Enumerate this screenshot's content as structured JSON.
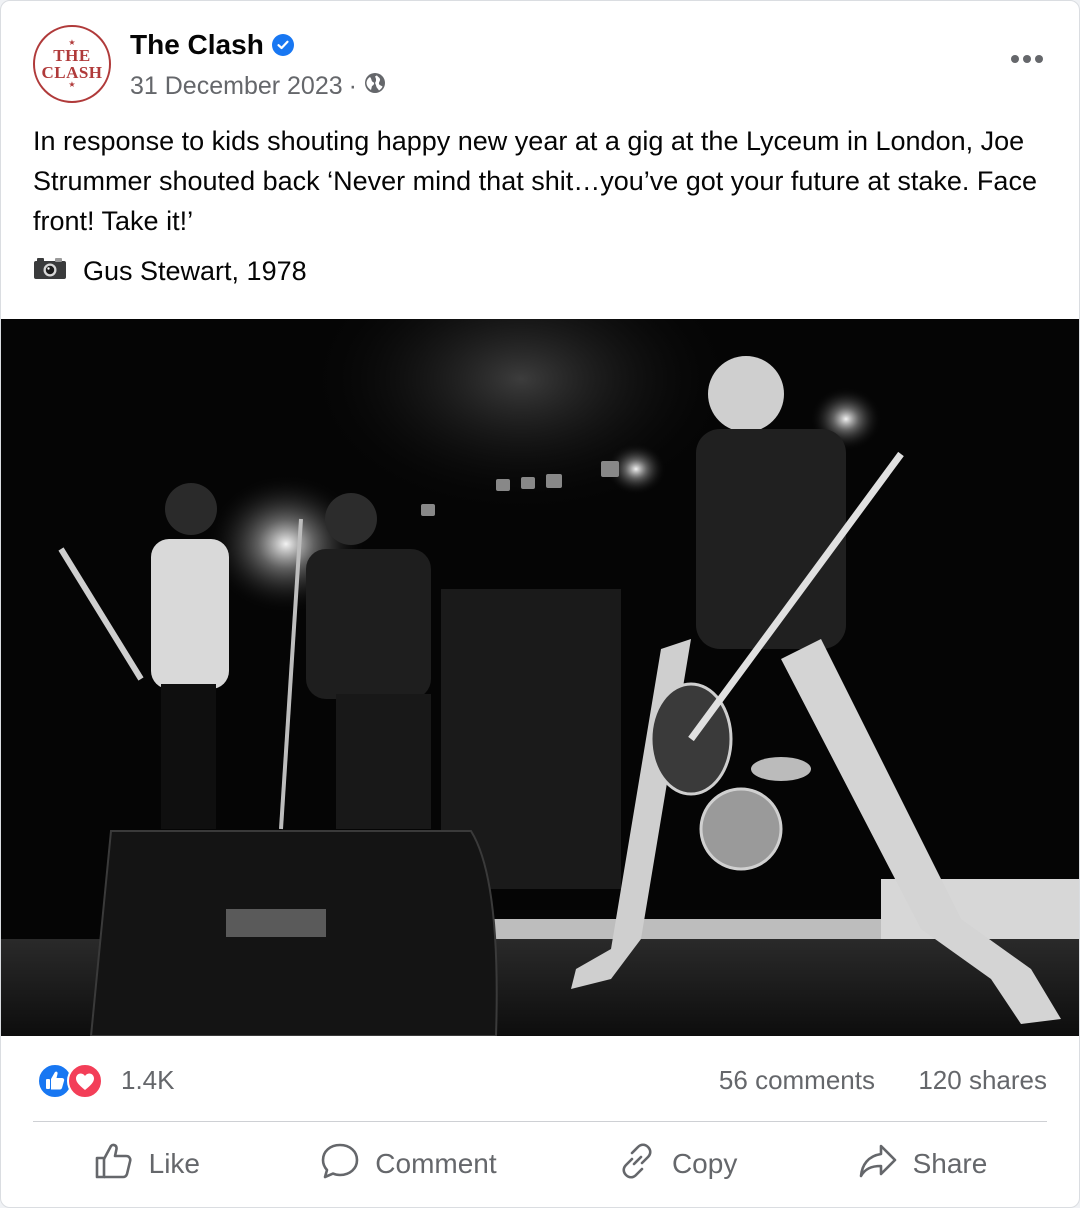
{
  "post": {
    "page_name": "The Clash",
    "avatar_logo_line1": "THE",
    "avatar_logo_line2": "CLASH",
    "date": "31 December 2023",
    "separator": "·",
    "privacy_icon": "globe-icon",
    "text": "In response to kids shouting happy new year at a gig at the Lyceum in London, Joe Strummer shouted back ‘Never mind that shit…you’ve got your future at stake. Face front! Take it!’",
    "credit_icon": "camera-icon",
    "credit": "Gus Stewart, 1978"
  },
  "stats": {
    "reactions": "1.4K",
    "comments": "56 comments",
    "shares": "120 shares"
  },
  "actions": {
    "like": "Like",
    "comment": "Comment",
    "copy": "Copy",
    "share": "Share"
  },
  "colors": {
    "accent": "#1877f2",
    "love": "#f33e58",
    "brand_red": "#b03a3a",
    "secondary_text": "#65676b"
  }
}
